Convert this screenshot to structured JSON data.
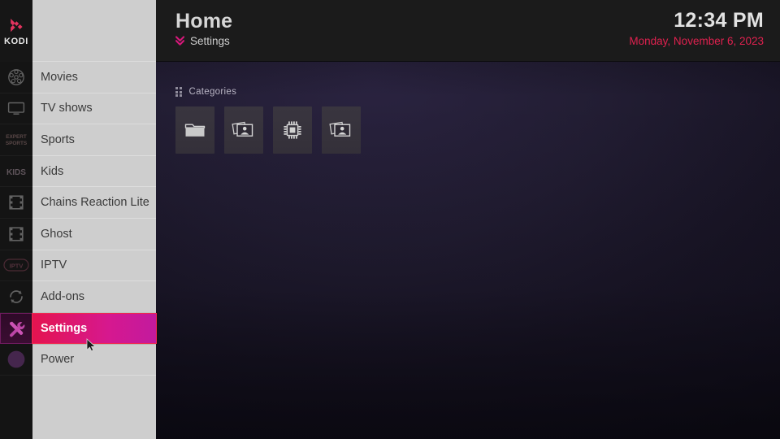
{
  "app": {
    "brand": "KODI",
    "accent_pink": "#e0214f",
    "accent_magenta": "#c21a9e",
    "sidebar_bg": "#cecece",
    "header_bg": "#1b1b1b"
  },
  "header": {
    "title": "Home",
    "breadcrumb_icon": "double-chevron-down-icon",
    "breadcrumb": "Settings",
    "time": "12:34 PM",
    "date": "Monday, November 6, 2023"
  },
  "rail": {
    "logo_label": "KODI",
    "logo_icon": "kodi-logo-icon",
    "items": [
      {
        "icon": "film-reel-icon",
        "name": "movies",
        "active": false
      },
      {
        "icon": "television-icon",
        "name": "tv-shows",
        "active": false
      },
      {
        "icon": "sports-logo-icon",
        "name": "sports",
        "active": false
      },
      {
        "icon": "kids-icon",
        "name": "kids",
        "active": false
      },
      {
        "icon": "film-strip-icon",
        "name": "chains-reaction-lite",
        "active": false
      },
      {
        "icon": "film-strip-icon",
        "name": "ghost",
        "active": false
      },
      {
        "icon": "iptv-logo-icon",
        "name": "iptv",
        "active": false
      },
      {
        "icon": "sync-arrows-icon",
        "name": "add-ons",
        "active": false
      },
      {
        "icon": "wrench-screwdriver-icon",
        "name": "settings",
        "active": true
      },
      {
        "icon": "power-circle-icon",
        "name": "power",
        "active": false
      }
    ]
  },
  "menu": {
    "items": [
      {
        "label": "Movies",
        "selected": false
      },
      {
        "label": "TV shows",
        "selected": false
      },
      {
        "label": "Sports",
        "selected": false
      },
      {
        "label": "Kids",
        "selected": false
      },
      {
        "label": "Chains Reaction Lite",
        "selected": false
      },
      {
        "label": "Ghost",
        "selected": false
      },
      {
        "label": "IPTV",
        "selected": false
      },
      {
        "label": "Add-ons",
        "selected": false
      },
      {
        "label": "Settings",
        "selected": true
      },
      {
        "label": "Power",
        "selected": false
      }
    ]
  },
  "content": {
    "categories_label": "Categories",
    "categories_icon": "grid-dots-icon",
    "tiles": [
      {
        "icon": "folder-icon",
        "name": "category-tile-folder"
      },
      {
        "icon": "pictures-stack-icon",
        "name": "category-tile-media"
      },
      {
        "icon": "cpu-chip-icon",
        "name": "category-tile-system"
      },
      {
        "icon": "pictures-stack-icon",
        "name": "category-tile-pictures"
      }
    ]
  },
  "cursor": {
    "icon": "mouse-pointer-icon"
  }
}
